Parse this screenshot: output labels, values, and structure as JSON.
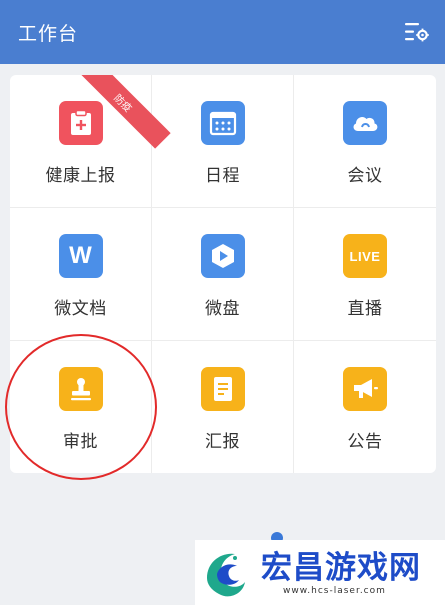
{
  "header": {
    "title": "工作台"
  },
  "colors": {
    "header_bg": "#4a7ed0",
    "red": "#f0535e",
    "blue": "#4b8fe8",
    "orange": "#f7b21a",
    "ribbon": "#e9525c",
    "circle": "#e22a2a"
  },
  "grid": [
    {
      "label": "健康上报",
      "icon": "clipboard-plus-icon",
      "ribbon": "防疫"
    },
    {
      "label": "日程",
      "icon": "calendar-icon"
    },
    {
      "label": "会议",
      "icon": "cloud-icon"
    },
    {
      "label": "微文档",
      "icon": "w-letter-icon",
      "icon_text": "W"
    },
    {
      "label": "微盘",
      "icon": "drive-icon"
    },
    {
      "label": "直播",
      "icon": "live-icon",
      "icon_text": "LIVE"
    },
    {
      "label": "审批",
      "icon": "stamp-icon"
    },
    {
      "label": "汇报",
      "icon": "report-icon"
    },
    {
      "label": "公告",
      "icon": "megaphone-icon"
    }
  ],
  "watermark": {
    "title": "宏昌游戏网",
    "url": "www.hcs-laser.com"
  }
}
